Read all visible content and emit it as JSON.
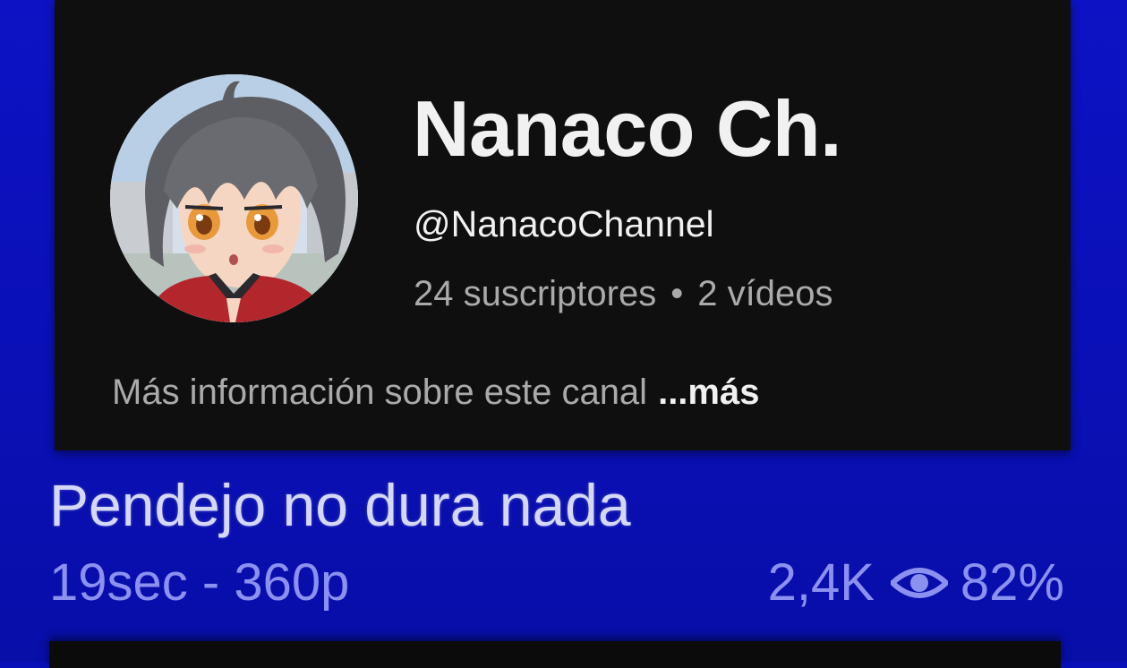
{
  "channel": {
    "name": "Nanaco Ch.",
    "handle": "@NanacoChannel",
    "subscribers": "24 suscriptores",
    "separator": "•",
    "videos": "2 vídeos",
    "description": "Más información sobre este canal",
    "more_label": "...más",
    "avatar_icon": "anime-avatar-icon"
  },
  "video": {
    "title": "Pendejo no dura nada",
    "meta": "19sec - 360p",
    "views": "2,4K",
    "views_icon": "eye-icon",
    "rating": "82%"
  },
  "colors": {
    "card_background": "#0f0f0f",
    "page_background": "#0a10b8",
    "primary_text": "#f1f1f1",
    "secondary_text": "#aaaaaa",
    "video_meta_text": "#8a91ee"
  }
}
